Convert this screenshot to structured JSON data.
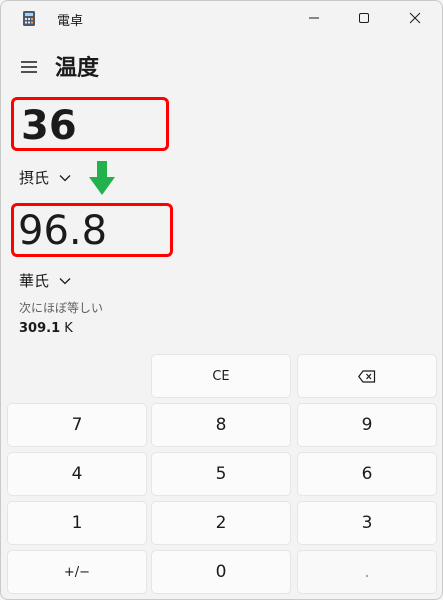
{
  "window": {
    "title": "電卓"
  },
  "header": {
    "title": "温度"
  },
  "input": {
    "value": "36",
    "unit": "摂氏"
  },
  "output": {
    "value": "96.8",
    "unit": "華氏"
  },
  "approx": {
    "label": "次にほぼ等しい",
    "value": "309.1",
    "unit": "K"
  },
  "keypad": {
    "ce": "CE",
    "k7": "7",
    "k8": "8",
    "k9": "9",
    "k4": "4",
    "k5": "5",
    "k6": "6",
    "k1": "1",
    "k2": "2",
    "k3": "3",
    "negate": "+/−",
    "k0": "0",
    "decimal": "."
  },
  "colors": {
    "highlight_box": "#ff0000",
    "arrow": "#22b14c",
    "background": "#f3f3f3"
  }
}
